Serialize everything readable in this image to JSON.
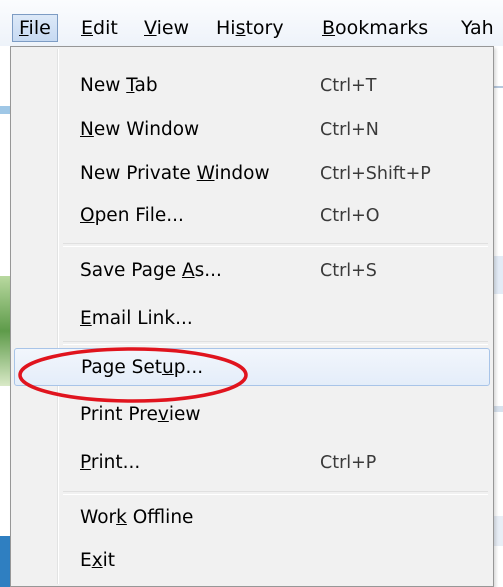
{
  "menubar": {
    "items": [
      {
        "label": "File",
        "key_index": 0
      },
      {
        "label": "Edit",
        "key_index": 0
      },
      {
        "label": "View",
        "key_index": 0
      },
      {
        "label": "History",
        "key_index": 2
      },
      {
        "label": "Bookmarks",
        "key_index": 0
      },
      {
        "label": "Yah",
        "key_index": -1
      }
    ]
  },
  "file_menu": {
    "items": [
      {
        "label": "New Tab",
        "key_index": 4,
        "shortcut": "Ctrl+T"
      },
      {
        "label": "New Window",
        "key_index": 0,
        "shortcut": "Ctrl+N"
      },
      {
        "label": "New Private Window",
        "key_index": 12,
        "shortcut": "Ctrl+Shift+P"
      },
      {
        "label": "Open File...",
        "key_index": 0,
        "shortcut": "Ctrl+O"
      },
      {
        "label": "Save Page As...",
        "key_index": 10,
        "shortcut": "Ctrl+S"
      },
      {
        "label": "Email Link...",
        "key_index": 0,
        "shortcut": ""
      },
      {
        "label": "Page Setup...",
        "key_index": 8,
        "shortcut": ""
      },
      {
        "label": "Print Preview",
        "key_index": 9,
        "shortcut": ""
      },
      {
        "label": "Print...",
        "key_index": 0,
        "shortcut": "Ctrl+P"
      },
      {
        "label": "Work Offline",
        "key_index": 3,
        "shortcut": ""
      },
      {
        "label": "Exit",
        "key_index": 1,
        "shortcut": ""
      }
    ],
    "highlighted": "Page Setup..."
  },
  "colors": {
    "annotation": "#e0141e",
    "hover_border": "#a8c4e8",
    "menu_bg": "#f1f1f1"
  }
}
